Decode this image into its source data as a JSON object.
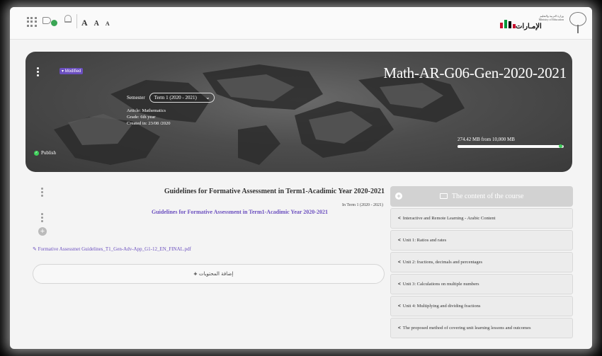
{
  "topbar": {
    "font_sizes": [
      "A",
      "A",
      "A"
    ],
    "uae_logo_text": "الإمـارات",
    "uae_logo_small": "وزارة التربية والتعليم Ministry of Education",
    "uae_bar_colors": [
      "#c8102e",
      "#009639",
      "#000000",
      "#c8102e"
    ],
    "notification_status_color": "#3aa655"
  },
  "banner": {
    "badge": "Modified",
    "title": "Math-AR-G06-Gen-2020-2021",
    "semester_label": "Semester",
    "semester_value": "Term 1 (2020 - 2021)",
    "article": "Article: Mathematics",
    "grade": "Grade: 6th year",
    "created": "Created in: 23/08 /2020",
    "publish": "Publish",
    "storage": "274.42 MB from 10,000 MB",
    "storage_fraction": 0.97
  },
  "section": {
    "title": "Guidelines for Formative Assessment in Term1-Acadimic Year 2020-2021",
    "term": "In Term 1 (2020 - 2021)",
    "subtitle": "Guidelines for Formative Assessment in Term1-Acadimic Year 2020-2021",
    "file": "Formative Assessmet Guidelines_T1_Gen-Adv-App_G1-12_EN_FINAL.pdf",
    "add_content": "إضافة المحتويات"
  },
  "course_content": {
    "header": "The content of the course",
    "items": [
      "Interactive and Remote Learning - Arabic Content",
      "Unit 1: Ratios and rates",
      "Unit 2: fractions, decimals and percentages",
      "Unit 3: Calculations on multiple numbers",
      "Unit 4: Multiplying and dividing fractions",
      "The proposed method of covering unit learning lessons and outcomes"
    ]
  }
}
